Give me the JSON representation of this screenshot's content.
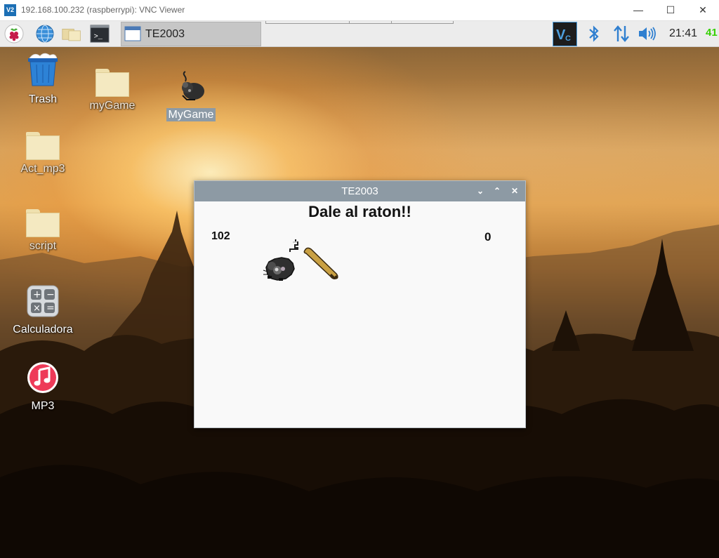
{
  "vnc": {
    "title": "192.168.100.232 (raspberrypi): VNC Viewer",
    "logo": "V2",
    "min_glyph": "—",
    "max_glyph": "☐",
    "close_glyph": "✕"
  },
  "taskbar": {
    "launchers": [
      "raspberry-menu-icon",
      "web-browser-icon",
      "file-manager-icon",
      "terminal-icon"
    ],
    "active_task": "TE2003",
    "tray": {
      "clock": "21:41",
      "cpu": "41",
      "icons": [
        "vnc-server-icon",
        "bluetooth-icon",
        "network-icon",
        "volume-icon"
      ]
    }
  },
  "desktop": {
    "icons": [
      {
        "label": "Trash",
        "icon": "trash-icon"
      },
      {
        "label": "myGame",
        "icon": "folder-icon"
      },
      {
        "label": "MyGame",
        "icon": "rat-icon",
        "selected": true
      },
      {
        "label": "Act_mp3",
        "icon": "folder-icon"
      },
      {
        "label": "script",
        "icon": "folder-icon"
      },
      {
        "label": "Calculadora",
        "icon": "calculator-icon"
      },
      {
        "label": "MP3",
        "icon": "music-icon"
      }
    ]
  },
  "game_window": {
    "title": "TE2003",
    "heading": "Dale al raton!!",
    "score_left": "102",
    "score_right": "0",
    "controls": {
      "minimize": "⌄",
      "maximize": "⌃",
      "close": "✕"
    }
  },
  "colors": {
    "window_titlebar": "#8d9aa4",
    "taskbar": "#ececec",
    "cpu_text": "#35d000",
    "vnc_accent": "#1c6fb5"
  }
}
